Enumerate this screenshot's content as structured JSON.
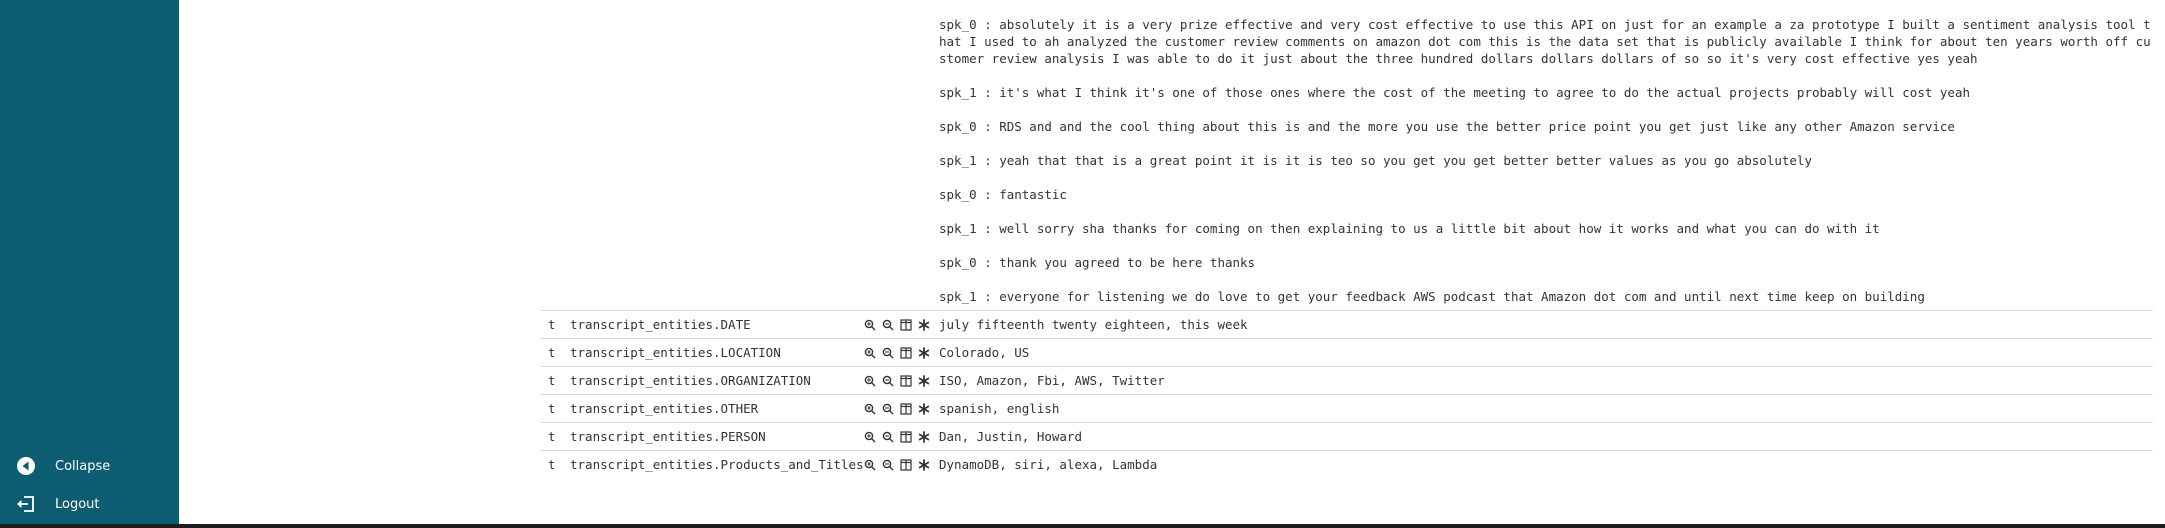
{
  "sidebar": {
    "collapse_label": "Collapse",
    "logout_label": "Logout",
    "collapse_icon": "circle-left-arrow-icon",
    "logout_icon": "logout-icon"
  },
  "transcript": [
    "spk_0 : absolutely it is a very prize effective and very cost effective to use this API on just for an example a za prototype I built a sentiment analysis tool that I used to ah analyzed the customer review comments on amazon dot com this is the data set that is publicly available I think for about ten years worth off customer review analysis I was able to do it just about the three hundred dollars dollars dollars of so so it's very cost effective yes yeah",
    "spk_1 : it's what I think it's one of those ones where the cost of the meeting to agree to do the actual projects probably will cost yeah",
    "spk_0 : RDS and and the cool thing about this is and the more you use the better price point you get just like any other Amazon service",
    "spk_1 : yeah that that is a great point it is it is teo so you get you get better better values as you go absolutely",
    "spk_0 : fantastic",
    "spk_1 : well sorry sha thanks for coming on then explaining to us a little bit about how it works and what you can do with it",
    "spk_0 : thank you agreed to be here thanks",
    "spk_1 : everyone for listening we do love to get your feedback AWS podcast that Amazon dot com and until next time keep on building"
  ],
  "entities": [
    {
      "type": "t",
      "key": "transcript_entities.DATE",
      "value": "july fifteenth twenty eighteen, this week"
    },
    {
      "type": "t",
      "key": "transcript_entities.LOCATION",
      "value": "Colorado, US"
    },
    {
      "type": "t",
      "key": "transcript_entities.ORGANIZATION",
      "value": "ISO, Amazon, Fbi, AWS, Twitter"
    },
    {
      "type": "t",
      "key": "transcript_entities.OTHER",
      "value": "spanish, english"
    },
    {
      "type": "t",
      "key": "transcript_entities.PERSON",
      "value": "Dan, Justin, Howard"
    },
    {
      "type": "t",
      "key": "transcript_entities.Products_and_Titles",
      "value": "DynamoDB, siri, alexa, Lambda"
    }
  ],
  "row_icons": [
    "zoom-in-icon",
    "zoom-out-icon",
    "columns-icon",
    "asterisk-icon"
  ],
  "colors": {
    "sidebar": "#0d5d72",
    "text": "#333333",
    "row_border": "#dddddd"
  }
}
